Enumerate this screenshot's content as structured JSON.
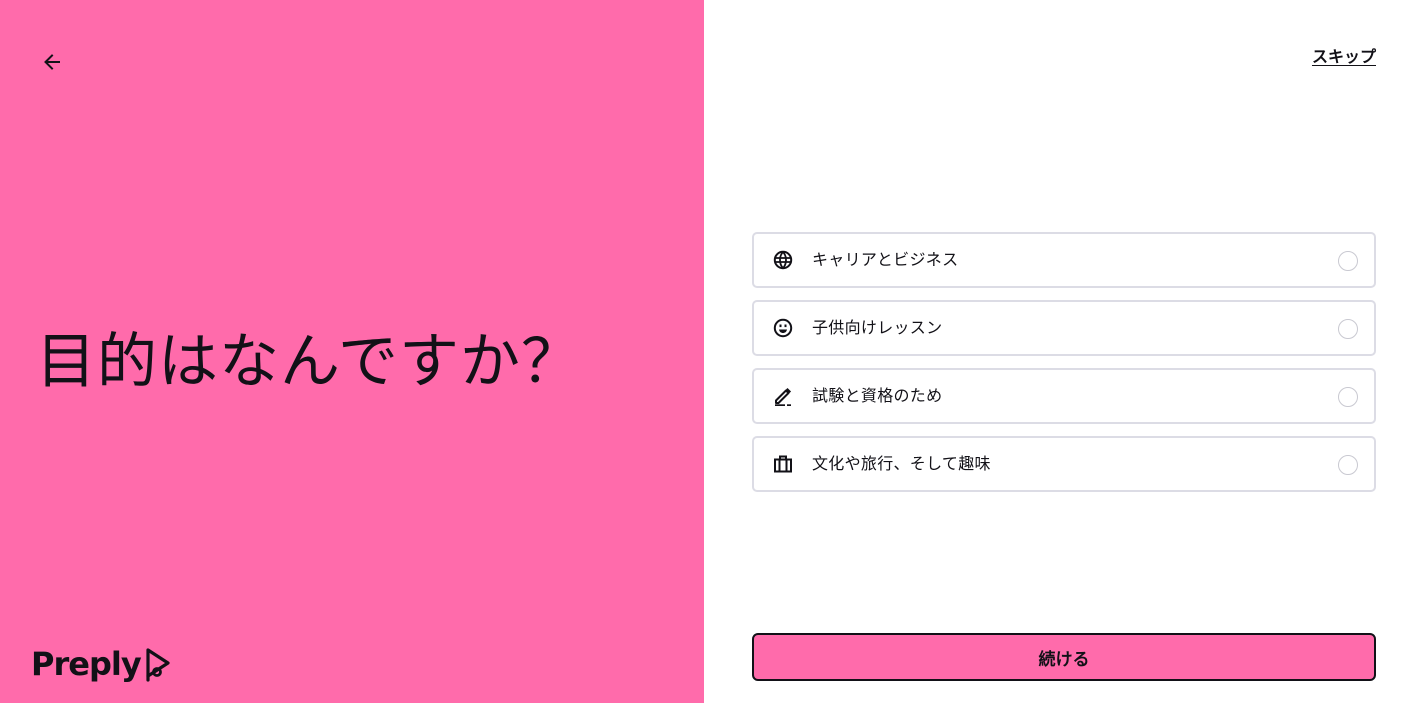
{
  "header": {
    "back_icon": "arrow-left-icon",
    "skip_label": "スキップ"
  },
  "main": {
    "title": "目的はなんですか？"
  },
  "brand": {
    "logo_text": "Preply",
    "accent_color": "#ff6bab"
  },
  "options": [
    {
      "label": "キャリアとビジネス",
      "icon": "globe-icon",
      "selected": false
    },
    {
      "label": "子供向けレッスン",
      "icon": "smiley-icon",
      "selected": false
    },
    {
      "label": "試験と資格のため",
      "icon": "pencil-icon",
      "selected": false
    },
    {
      "label": "文化や旅行、そして趣味",
      "icon": "suitcase-icon",
      "selected": false
    }
  ],
  "footer": {
    "continue_label": "続ける"
  }
}
